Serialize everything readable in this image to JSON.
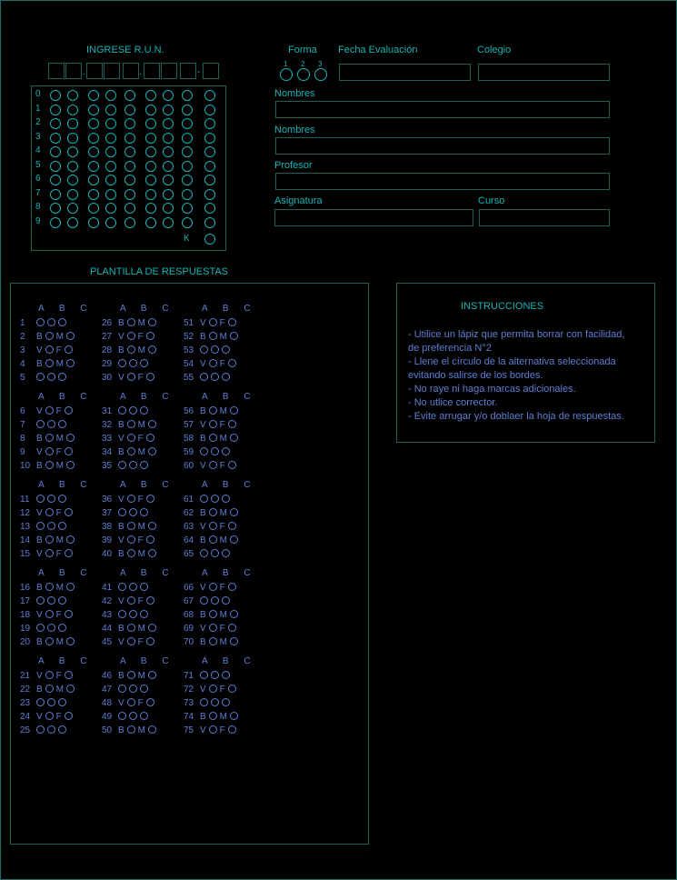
{
  "run": {
    "title": "INGRESE R.U.N.",
    "dot": ".",
    "dash": "-",
    "digits": [
      "0",
      "1",
      "2",
      "3",
      "4",
      "5",
      "6",
      "7",
      "8",
      "9"
    ],
    "k_label": "K"
  },
  "form": {
    "forma_label": "Forma",
    "forma_options": [
      "1",
      "2",
      "3"
    ],
    "fecha_label": "Fecha Evaluación",
    "colegio_label": "Colegio",
    "nombres_label_1": "Nombres",
    "nombres_label_2": "Nombres",
    "profesor_label": "Profesor",
    "asignatura_label": "Asignatura",
    "curso_label": "Curso"
  },
  "answers": {
    "title": "PLANTILLA DE RESPUESTAS",
    "column_header": "A B C"
  },
  "questions": [
    {
      "n": "1",
      "t": "c"
    },
    {
      "n": "2",
      "t": "bm"
    },
    {
      "n": "3",
      "t": "vf"
    },
    {
      "n": "4",
      "t": "bm"
    },
    {
      "n": "5",
      "t": "c"
    },
    {
      "n": "6",
      "t": "vf"
    },
    {
      "n": "7",
      "t": "c"
    },
    {
      "n": "8",
      "t": "bm"
    },
    {
      "n": "9",
      "t": "vf"
    },
    {
      "n": "10",
      "t": "bm"
    },
    {
      "n": "11",
      "t": "c"
    },
    {
      "n": "12",
      "t": "vf"
    },
    {
      "n": "13",
      "t": "c"
    },
    {
      "n": "14",
      "t": "bm"
    },
    {
      "n": "15",
      "t": "vf"
    },
    {
      "n": "16",
      "t": "bm"
    },
    {
      "n": "17",
      "t": "c"
    },
    {
      "n": "18",
      "t": "vf"
    },
    {
      "n": "19",
      "t": "c"
    },
    {
      "n": "20",
      "t": "bm"
    },
    {
      "n": "21",
      "t": "vf"
    },
    {
      "n": "22",
      "t": "bm"
    },
    {
      "n": "23",
      "t": "c"
    },
    {
      "n": "24",
      "t": "vf"
    },
    {
      "n": "25",
      "t": "c"
    },
    {
      "n": "26",
      "t": "bm"
    },
    {
      "n": "27",
      "t": "vf"
    },
    {
      "n": "28",
      "t": "bm"
    },
    {
      "n": "29",
      "t": "c"
    },
    {
      "n": "30",
      "t": "vf"
    },
    {
      "n": "31",
      "t": "c"
    },
    {
      "n": "32",
      "t": "bm"
    },
    {
      "n": "33",
      "t": "vf"
    },
    {
      "n": "34",
      "t": "bm"
    },
    {
      "n": "35",
      "t": "c"
    },
    {
      "n": "36",
      "t": "vf"
    },
    {
      "n": "37",
      "t": "c"
    },
    {
      "n": "38",
      "t": "bm"
    },
    {
      "n": "39",
      "t": "vf"
    },
    {
      "n": "40",
      "t": "bm"
    },
    {
      "n": "41",
      "t": "c"
    },
    {
      "n": "42",
      "t": "vf"
    },
    {
      "n": "43",
      "t": "c"
    },
    {
      "n": "44",
      "t": "bm"
    },
    {
      "n": "45",
      "t": "vf"
    },
    {
      "n": "46",
      "t": "bm"
    },
    {
      "n": "47",
      "t": "c"
    },
    {
      "n": "48",
      "t": "vf"
    },
    {
      "n": "49",
      "t": "c"
    },
    {
      "n": "50",
      "t": "bm"
    },
    {
      "n": "51",
      "t": "vf"
    },
    {
      "n": "52",
      "t": "bm"
    },
    {
      "n": "53",
      "t": "c"
    },
    {
      "n": "54",
      "t": "vf"
    },
    {
      "n": "55",
      "t": "c"
    },
    {
      "n": "56",
      "t": "bm"
    },
    {
      "n": "57",
      "t": "vf"
    },
    {
      "n": "58",
      "t": "bm"
    },
    {
      "n": "59",
      "t": "c"
    },
    {
      "n": "60",
      "t": "vf"
    },
    {
      "n": "61",
      "t": "c"
    },
    {
      "n": "62",
      "t": "bm"
    },
    {
      "n": "63",
      "t": "vf"
    },
    {
      "n": "64",
      "t": "bm"
    },
    {
      "n": "65",
      "t": "c"
    },
    {
      "n": "66",
      "t": "vf"
    },
    {
      "n": "67",
      "t": "c"
    },
    {
      "n": "68",
      "t": "bm"
    },
    {
      "n": "69",
      "t": "vf"
    },
    {
      "n": "70",
      "t": "bm"
    },
    {
      "n": "71",
      "t": "c"
    },
    {
      "n": "72",
      "t": "vf"
    },
    {
      "n": "73",
      "t": "c"
    },
    {
      "n": "74",
      "t": "bm"
    },
    {
      "n": "75",
      "t": "vf"
    }
  ],
  "marks": {
    "c": [],
    "bm": [
      "B",
      "M"
    ],
    "vf": [
      "V",
      "F"
    ]
  },
  "instructions": {
    "title": "INSTRUCCIONES",
    "lines": [
      "- Utilice un lápiz que permita borrar con facilidad,",
      "de preferencia N°2",
      "- Llene el círculo de la alternativa seleccionada",
      "evitando salirse de los bordes.",
      "- No raye ni haga marcas adicionales.",
      "- No utlice corrector.",
      "- Evite arrugar y/o doblaer la hoja de respuestas."
    ]
  },
  "colors": {
    "cyan": "#17b3b3",
    "blue": "#5f7fd4",
    "border": "#1c5f58",
    "background": "#000000"
  }
}
